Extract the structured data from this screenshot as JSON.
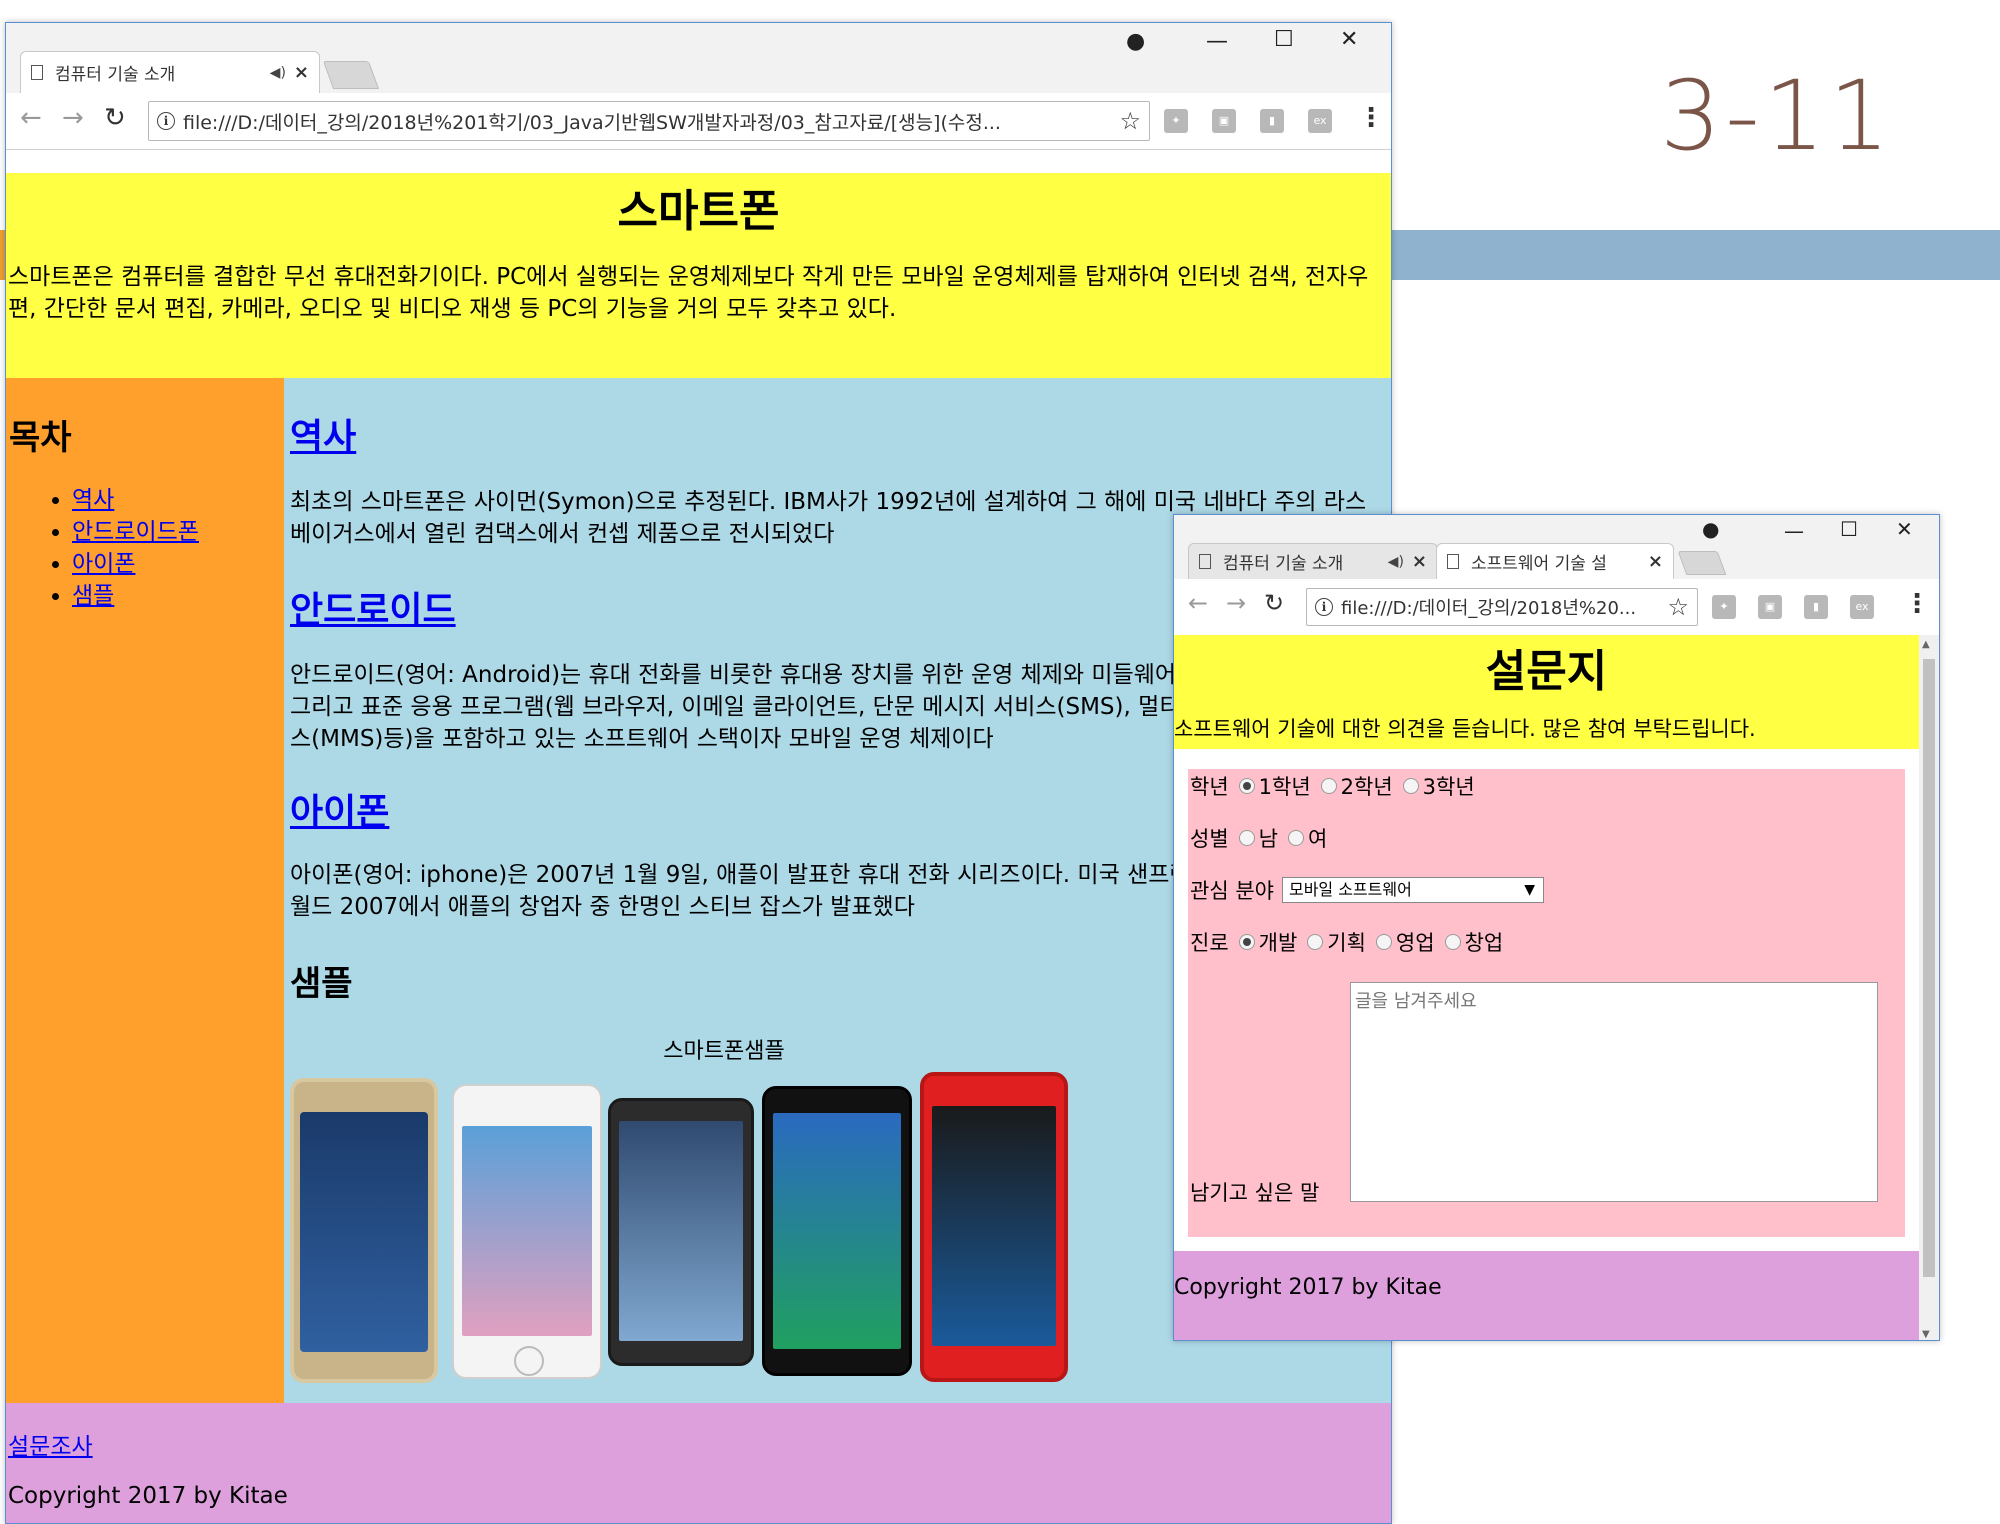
{
  "slide": {
    "number": "3-11"
  },
  "window1": {
    "tab_title": "컴퓨터 기술 소개",
    "url": "file:///D:/데이터_강의/2018년%201학기/03_Java기반웹SW개발자과정/03_참고자료/[생능](수정...",
    "header_title": "스마트폰",
    "header_desc": "스마트폰은 컴퓨터를 결합한 무선 휴대전화기이다. PC에서 실행되는 운영체제보다 작게 만든 모바일 운영체제를 탑재하여 인터넷 검색, 전자우편, 간단한 문서 편집, 카메라, 오디오 및 비디오 재생 등 PC의 기능을 거의 모두 갖추고 있다.",
    "nav_title": "목차",
    "nav_items": [
      "역사",
      "안드로이드폰",
      "아이폰",
      "샘플"
    ],
    "sections": [
      {
        "title": "역사",
        "text": "최초의 스마트폰은 사이먼(Symon)으로 추정된다. IBM사가 1992년에 설계하여 그 해에 미국 네바다 주의 라스베이거스에서 열린 컴댁스에서 컨셉 제품으로 전시되었다"
      },
      {
        "title": "안드로이드",
        "text": "안드로이드(영어: Android)는 휴대 전화를 비롯한 휴대용 장치를 위한 운영 체제와 미들웨어, 사용자 인터페이스 그리고 표준 응용 프로그램(웹 브라우저, 이메일 클라이언트, 단문 메시지 서비스(SMS), 멀티미디어 메시지 서비스(MMS)등)을 포함하고 있는 소프트웨어 스택이자 모바일 운영 체제이다"
      },
      {
        "title": "아이폰",
        "text": "아이폰(영어: iphone)은 2007년 1월 9일, 애플이 발표한 휴대 전화 시리즈이다. 미국 샌프란시스코에서 열린 맥월드 2007에서 애플의 창업자 중 한명인 스티브 잡스가 발표했다"
      }
    ],
    "sample_title": "샘플",
    "sample_caption": "스마트폰샘플",
    "footer_link": "설문조사",
    "footer_copyright": "Copyright 2017 by Kitae"
  },
  "window2": {
    "tab1_title": "컴퓨터 기술 소개",
    "tab2_title": "소프트웨어 기술 설",
    "url": "file:///D:/데이터_강의/2018년%20...",
    "header_title": "설문지",
    "header_desc": "소프트웨어 기술에 대한 의견을 듣습니다. 많은 참여 부탁드립니다.",
    "form": {
      "grade_label": "학년",
      "grade_options": [
        "1학년",
        "2학년",
        "3학년"
      ],
      "gender_label": "성별",
      "gender_options": [
        "남",
        "여"
      ],
      "interest_label": "관심 분야",
      "interest_value": "모바일 소프트웨어",
      "career_label": "진로",
      "career_options": [
        "개발",
        "기획",
        "영업",
        "창업"
      ],
      "comment_label": "남기고 싶은 말",
      "comment_placeholder": "글을 남겨주세요"
    },
    "footer_copyright": "Copyright 2017 by Kitae"
  },
  "phone_colors": [
    "#c9b48a",
    "#f0f0f0",
    "#2c2c2c",
    "#111111",
    "#e02020"
  ]
}
